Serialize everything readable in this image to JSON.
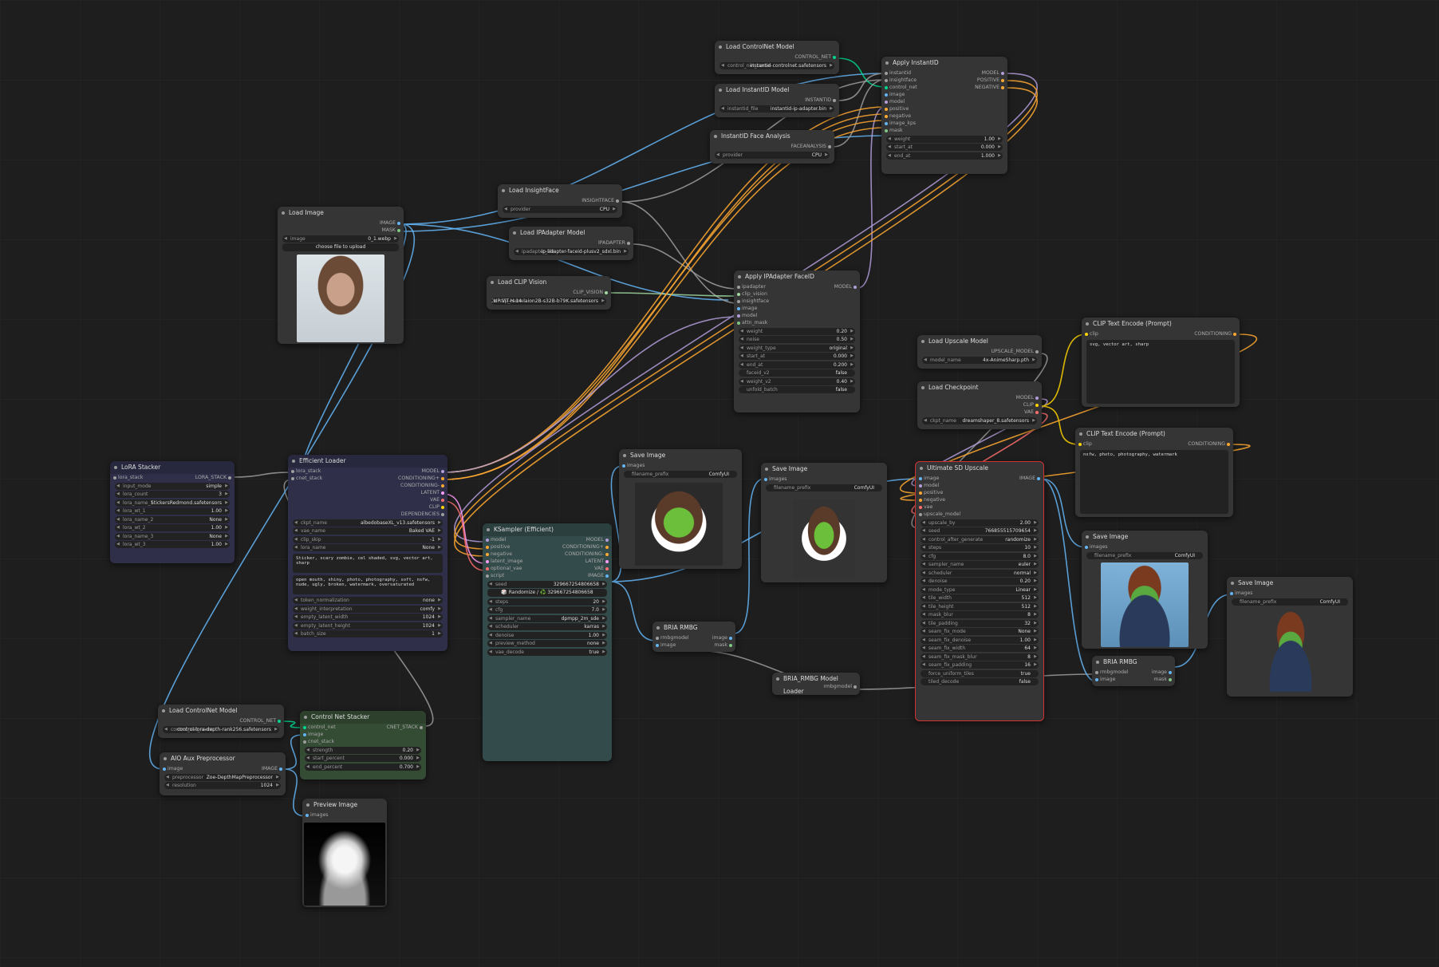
{
  "colors": {
    "background": "#1e1e1e",
    "node_body": "#353535",
    "model": "#b39ddb",
    "conditioning": "#ffa931",
    "image": "#64b5f6",
    "clip": "#ffd500",
    "vae": "#ff6e6e",
    "latent": "#ff9cf9",
    "control_net": "#00d78d",
    "highlight": "#c33"
  },
  "nodes": {
    "load_controlnet_top": {
      "title": "Load ControlNet Model",
      "out": "CONTROL_NET",
      "w_name": "control_net_name",
      "w_value": "instantid-controlnet.safetensors"
    },
    "load_instantid": {
      "title": "Load InstantID Model",
      "out": "INSTANTID",
      "w_name": "instantid_file",
      "w_value": "instantid-ip-adapter.bin"
    },
    "instantid_face": {
      "title": "InstantID Face Analysis",
      "out": "FACEANALYSIS",
      "w_name": "provider",
      "w_value": "CPU"
    },
    "apply_instantid": {
      "title": "Apply InstantID",
      "inputs": [
        "instantid",
        "insightface",
        "control_net",
        "image",
        "model",
        "positive",
        "negative",
        "image_kps",
        "mask"
      ],
      "outputs": [
        "MODEL",
        "POSITIVE",
        "NEGATIVE"
      ],
      "widgets": [
        {
          "name": "weight",
          "value": "1.00"
        },
        {
          "name": "start_at",
          "value": "0.000"
        },
        {
          "name": "end_at",
          "value": "1.000"
        }
      ]
    },
    "load_insightface": {
      "title": "Load InsightFace",
      "out": "INSIGHTFACE",
      "w_name": "provider",
      "w_value": "CPU"
    },
    "load_ipadapter": {
      "title": "Load IPAdapter Model",
      "out": "IPADAPTER",
      "w_name": "ipadapter_file",
      "w_value": "ip-adapter-faceid-plusv2_sdxl.bin"
    },
    "load_clip_vision": {
      "title": "Load CLIP Vision",
      "out": "CLIP_VISION",
      "w_name": "clip_name",
      "w_value": "CLIP-ViT-H-14-laion2B-s32B-b79K.safetensors"
    },
    "load_image": {
      "title": "Load Image",
      "outputs": [
        "IMAGE",
        "MASK"
      ],
      "w_name": "image",
      "w_value": "0_1.webp",
      "upload": "choose file to upload"
    },
    "apply_ipadapter": {
      "title": "Apply IPAdapter FaceID",
      "inputs": [
        "ipadapter",
        "clip_vision",
        "insightface",
        "image",
        "model",
        "attn_mask"
      ],
      "out": "MODEL",
      "widgets": [
        {
          "name": "weight",
          "value": "0.20"
        },
        {
          "name": "noise",
          "value": "0.50"
        },
        {
          "name": "weight_type",
          "value": "original"
        },
        {
          "name": "start_at",
          "value": "0.000"
        },
        {
          "name": "end_at",
          "value": "0.200"
        },
        {
          "name": "faceid_v2",
          "value": "false"
        },
        {
          "name": "weight_v2",
          "value": "0.40"
        },
        {
          "name": "unfold_batch",
          "value": "false"
        }
      ]
    },
    "load_upscale": {
      "title": "Load Upscale Model",
      "out": "UPSCALE_MODEL",
      "w_name": "model_name",
      "w_value": "4x-AnimeSharp.pth"
    },
    "load_checkpoint": {
      "title": "Load Checkpoint",
      "outputs": [
        "MODEL",
        "CLIP",
        "VAE"
      ],
      "w_name": "ckpt_name",
      "w_value": "dreamshaper_8.safetensors"
    },
    "clip_pos": {
      "title": "CLIP Text Encode (Prompt)",
      "in": "clip",
      "out": "CONDITIONING",
      "text": "svg, vector art, sharp"
    },
    "clip_neg": {
      "title": "CLIP Text Encode (Prompt)",
      "in": "clip",
      "out": "CONDITIONING",
      "text": "nsfw, photo, photography, watermark"
    },
    "lora_stacker": {
      "title": "LoRA Stacker",
      "in": "lora_stack",
      "out": "LORA_STACK",
      "widgets": [
        {
          "name": "input_mode",
          "value": "simple"
        },
        {
          "name": "lora_count",
          "value": "3"
        },
        {
          "name": "lora_name_1",
          "value": "StickersRedmond.safetensors"
        },
        {
          "name": "lora_wt_1",
          "value": "1.00"
        },
        {
          "name": "lora_name_2",
          "value": "None"
        },
        {
          "name": "lora_wt_2",
          "value": "1.00"
        },
        {
          "name": "lora_name_3",
          "value": "None"
        },
        {
          "name": "lora_wt_3",
          "value": "1.00"
        }
      ]
    },
    "efficient_loader": {
      "title": "Efficient Loader",
      "inputs": [
        "lora_stack",
        "cnet_stack"
      ],
      "outputs": [
        "MODEL",
        "CONDITIONING+",
        "CONDITIONING-",
        "LATENT",
        "VAE",
        "CLIP",
        "DEPENDENCIES"
      ],
      "widgets": [
        {
          "name": "ckpt_name",
          "value": "albedobaseXL_v13.safetensors"
        },
        {
          "name": "vae_name",
          "value": "Baked VAE"
        },
        {
          "name": "clip_skip",
          "value": "-1"
        },
        {
          "name": "lora_name",
          "value": "None"
        }
      ],
      "positive": "Sticker, scary zombie, cel shaded, svg, vector art, sharp",
      "negative": "open mouth, shiny, photo, photography, soft, nsfw, nude, ugly, broken, watermark, oversaturated",
      "widgets2": [
        {
          "name": "token_normalization",
          "value": "none"
        },
        {
          "name": "weight_interpretation",
          "value": "comfy"
        },
        {
          "name": "empty_latent_width",
          "value": "1024"
        },
        {
          "name": "empty_latent_height",
          "value": "1024"
        },
        {
          "name": "batch_size",
          "value": "1"
        }
      ]
    },
    "ksampler": {
      "title": "KSampler (Efficient)",
      "inputs": [
        "model",
        "positive",
        "negative",
        "latent_image",
        "optional_vae",
        "script"
      ],
      "outputs": [
        "MODEL",
        "CONDITIONING+",
        "CONDITIONING-",
        "LATENT",
        "VAE",
        "IMAGE"
      ],
      "seed_name": "seed",
      "seed": "329667254806658",
      "randomize": "🎲 Randomize / ♻️ 329667254806658",
      "widgets": [
        {
          "name": "steps",
          "value": "20"
        },
        {
          "name": "cfg",
          "value": "7.0"
        },
        {
          "name": "sampler_name",
          "value": "dpmpp_2m_sde"
        },
        {
          "name": "scheduler",
          "value": "karras"
        },
        {
          "name": "denoise",
          "value": "1.00"
        },
        {
          "name": "preview_method",
          "value": "none"
        },
        {
          "name": "vae_decode",
          "value": "true"
        }
      ]
    },
    "save1": {
      "title": "Save Image",
      "in": "images",
      "w_name": "filename_prefix",
      "w_value": "ComfyUI"
    },
    "save2": {
      "title": "Save Image",
      "in": "images",
      "w_name": "filename_prefix",
      "w_value": "ComfyUI"
    },
    "save3": {
      "title": "Save Image",
      "in": "images",
      "w_name": "filename_prefix",
      "w_value": "ComfyUI"
    },
    "save4": {
      "title": "Save Image",
      "in": "images",
      "w_name": "filename_prefix",
      "w_value": "ComfyUI"
    },
    "bria1": {
      "title": "BRIA RMBG",
      "inputs": [
        "rmbgmodel",
        "image"
      ],
      "outputs": [
        "image",
        "mask"
      ]
    },
    "bria2": {
      "title": "BRIA RMBG",
      "inputs": [
        "rmbgmodel",
        "image"
      ],
      "outputs": [
        "image",
        "mask"
      ]
    },
    "bria_loader": {
      "title": "BRIA_RMBG Model Loader",
      "out": "rmbgmodel"
    },
    "ultimate": {
      "title": "Ultimate SD Upscale",
      "inputs": [
        "image",
        "model",
        "positive",
        "negative",
        "vae",
        "upscale_model"
      ],
      "out": "IMAGE",
      "widgets": [
        {
          "name": "upscale_by",
          "value": "2.00"
        },
        {
          "name": "seed",
          "value": "766855515709654"
        },
        {
          "name": "control_after_generate",
          "value": "randomize"
        },
        {
          "name": "steps",
          "value": "10"
        },
        {
          "name": "cfg",
          "value": "8.0"
        },
        {
          "name": "sampler_name",
          "value": "euler"
        },
        {
          "name": "scheduler",
          "value": "normal"
        },
        {
          "name": "denoise",
          "value": "0.20"
        },
        {
          "name": "mode_type",
          "value": "Linear"
        },
        {
          "name": "tile_width",
          "value": "512"
        },
        {
          "name": "tile_height",
          "value": "512"
        },
        {
          "name": "mask_blur",
          "value": "8"
        },
        {
          "name": "tile_padding",
          "value": "32"
        },
        {
          "name": "seam_fix_mode",
          "value": "None"
        },
        {
          "name": "seam_fix_denoise",
          "value": "1.00"
        },
        {
          "name": "seam_fix_width",
          "value": "64"
        },
        {
          "name": "seam_fix_mask_blur",
          "value": "8"
        },
        {
          "name": "seam_fix_padding",
          "value": "16"
        },
        {
          "name": "force_uniform_tiles",
          "value": "true"
        },
        {
          "name": "tiled_decode",
          "value": "false"
        }
      ]
    },
    "load_controlnet_bottom": {
      "title": "Load ControlNet Model",
      "out": "CONTROL_NET",
      "w_name": "control_net_name",
      "w_value": "control-lora-depth-rank256.safetensors"
    },
    "controlnet_stacker": {
      "title": "Control Net Stacker",
      "inputs": [
        "control_net",
        "image",
        "cnet_stack"
      ],
      "out": "CNET_STACK",
      "widgets": [
        {
          "name": "strength",
          "value": "0.20"
        },
        {
          "name": "start_percent",
          "value": "0.000"
        },
        {
          "name": "end_percent",
          "value": "0.700"
        }
      ]
    },
    "aio_aux": {
      "title": "AIO Aux Preprocessor",
      "in": "image",
      "out": "IMAGE",
      "widgets": [
        {
          "name": "preprocessor",
          "value": "Zoe-DepthMapPreprocessor"
        },
        {
          "name": "resolution",
          "value": "1024"
        }
      ]
    },
    "preview": {
      "title": "Preview Image",
      "in": "images"
    }
  }
}
